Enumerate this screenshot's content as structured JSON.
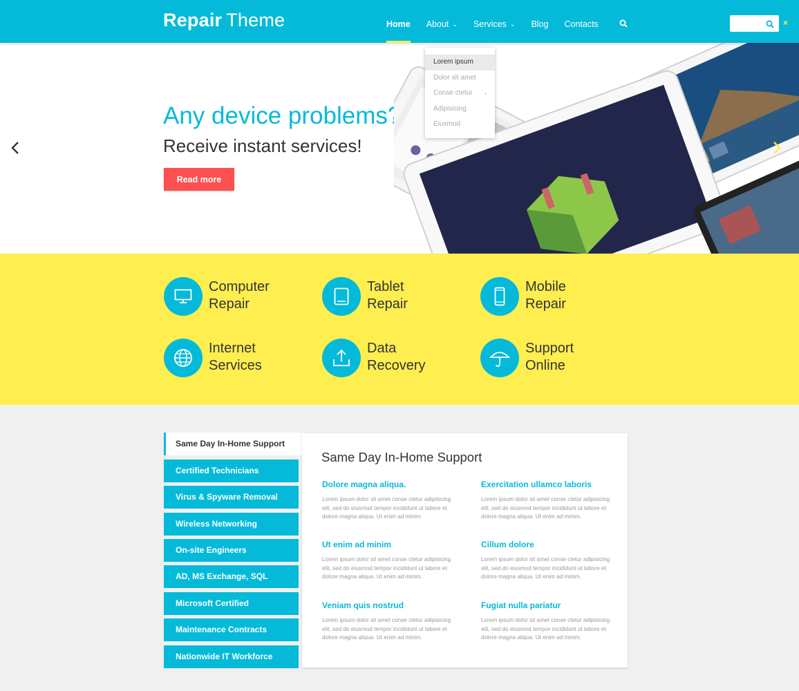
{
  "brand": {
    "bold": "Repair",
    "light": "Theme"
  },
  "nav": {
    "items": [
      {
        "label": "Home",
        "dropdown": false,
        "active": true
      },
      {
        "label": "About",
        "dropdown": true,
        "active": false
      },
      {
        "label": "Services",
        "dropdown": true,
        "active": false
      },
      {
        "label": "Blog",
        "dropdown": false,
        "active": false
      },
      {
        "label": "Contacts",
        "dropdown": false,
        "active": false
      }
    ],
    "search_icon": "search-icon",
    "close_icon": "close-icon",
    "close_label": "×",
    "search_value": ""
  },
  "dropdown": {
    "items": [
      "Lorem ipsum",
      "Dolor sit amet",
      "Conse ctetur",
      "Adipisicing",
      "Eiusmod"
    ],
    "submenu_marker": "›"
  },
  "hero": {
    "title": "Any device problems?",
    "subtitle": "Receive instant services!",
    "button": "Read more",
    "prev_icon": "chevron-left-icon",
    "next_icon": "chevron-right-icon"
  },
  "services": [
    {
      "label": "Computer\nRepair",
      "icon": "monitor-icon"
    },
    {
      "label": "Tablet\nRepair",
      "icon": "tablet-icon"
    },
    {
      "label": "Mobile\nRepair",
      "icon": "mobile-icon"
    },
    {
      "label": "Internet\nServices",
      "icon": "globe-icon"
    },
    {
      "label": "Data\nRecovery",
      "icon": "upload-icon"
    },
    {
      "label": "Support\nOnline",
      "icon": "umbrella-icon"
    }
  ],
  "tabs": [
    "Same Day In-Home Support",
    "Certified Technicians",
    "Virus & Spyware Removal",
    "Wireless Networking",
    "On-site Engineers",
    "AD, MS Exchange, SQL",
    "Microsoft Certified",
    "Maintenance Contracts",
    "Nationwide IT Workforce"
  ],
  "panel": {
    "title": "Same Day In-Home Support",
    "features": [
      {
        "title": "Dolore magna aliqua.",
        "text": "Lorem ipsum dolor sit amet conse ctetur adipisicing elit, sed do eiusmod tempor incididunt ut labore et dolore magna aliqua. Ut enim ad minim."
      },
      {
        "title": "Exercitation ullamco laboris",
        "text": "Lorem ipsum dolor sit amet conse ctetur adipisicing elit, sed do eiusmod tempor incididunt ut labore et dolore magna aliqua. Ut enim ad minim."
      },
      {
        "title": "Ut enim ad minim",
        "text": "Lorem ipsum dolor sit amet conse ctetur adipisicing elit, sed do eiusmod tempor incididunt ut labore et dolore magna aliqua. Ut enim ad minim."
      },
      {
        "title": "Cillum dolore",
        "text": "Lorem ipsum dolor sit amet conse ctetur adipisicing elit, sed do eiusmod tempor incididunt ut labore et dolore magna aliqua. Ut enim ad minim."
      },
      {
        "title": "Veniam quis nostrud",
        "text": "Lorem ipsum dolor sit amet conse ctetur adipisicing elit, sed do eiusmod tempor incididunt ut labore et dolore magna aliqua. Ut enim ad minim."
      },
      {
        "title": "Fugiat nulla pariatur",
        "text": "Lorem ipsum dolor sit amet conse ctetur adipisicing elit, sed do eiusmod tempor incididunt ut labore et dolore magna aliqua. Ut enim ad minim."
      }
    ]
  },
  "colors": {
    "primary": "#05bad9",
    "accent_yellow": "#ffee4f",
    "button_red": "#fd5050"
  }
}
